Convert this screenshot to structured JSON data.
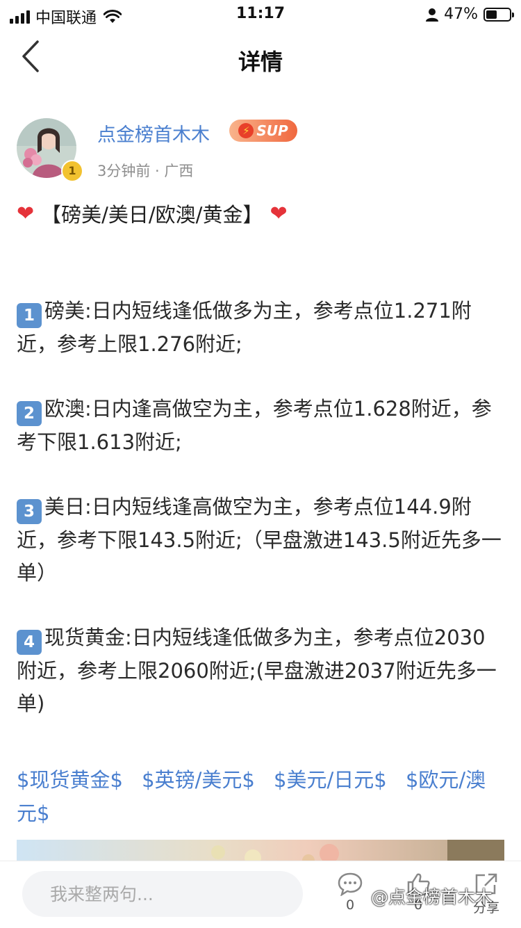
{
  "status_bar": {
    "carrier": "中国联通",
    "time": "11:17",
    "battery": "47%",
    "battery_level": 0.47
  },
  "nav": {
    "title": "详情",
    "back_icon": "chevron-left-icon"
  },
  "author": {
    "name": "点金榜首木木",
    "badge": "SUP",
    "level": "1",
    "meta": "3分钟前 · 广西"
  },
  "post": {
    "title": "【磅美/美日/欧澳/黄金】",
    "title_icon": "heart-icon",
    "items": [
      {
        "num": "1",
        "text": "磅美:日内短线逢低做多为主，参考点位1.271附近，参考上限1.276附近;"
      },
      {
        "num": "2",
        "text": "欧澳:日内逢高做空为主，参考点位1.628附近，参考下限1.613附近;"
      },
      {
        "num": "3",
        "text": "美日:日内短线逢高做空为主，参考点位144.9附近，参考下限143.5附近;（早盘激进143.5附近先多一单）"
      },
      {
        "num": "4",
        "text": "现货黄金:日内短线逢低做多为主，参考点位2030附近，参考上限2060附近;(早盘激进2037附近先多一单)"
      }
    ],
    "tags": [
      "$现货黄金$",
      "$英镑/美元$",
      "$美元/日元$",
      "$欧元/澳元$"
    ]
  },
  "bottom_bar": {
    "placeholder": "我来整两句...",
    "comment_count": "0",
    "like_count": "0",
    "share_label": "分享",
    "watermark": "@点金榜首木木"
  },
  "colors": {
    "accent": "#4a7fcf",
    "keycap": "#5c92cf",
    "badge": "#f0683f"
  }
}
